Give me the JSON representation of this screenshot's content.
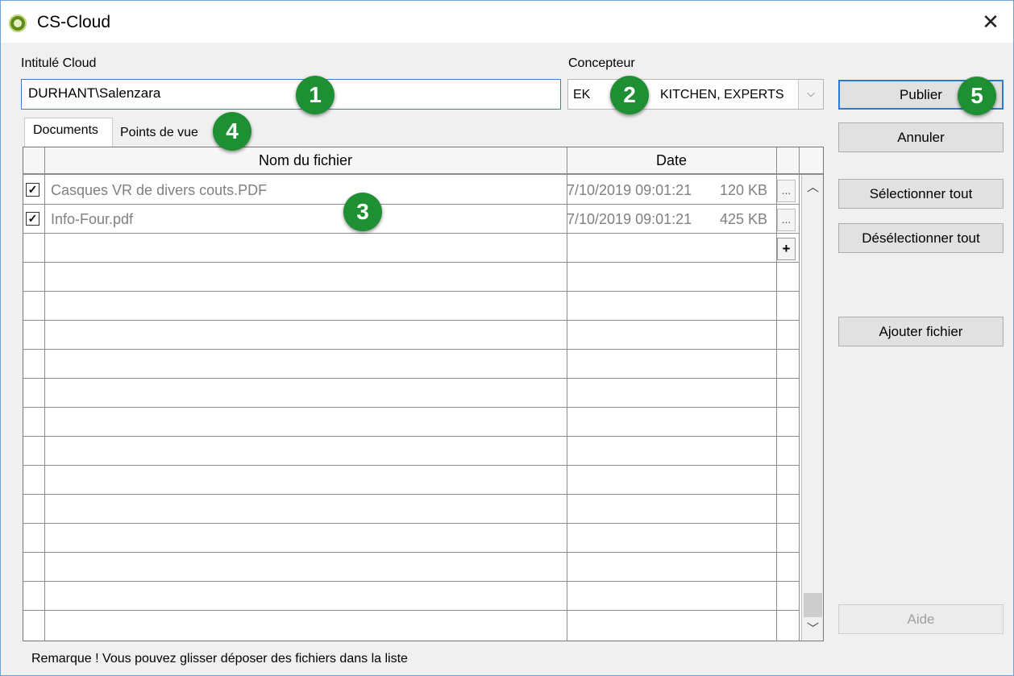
{
  "window": {
    "title": "CS-Cloud",
    "close_glyph": "✕"
  },
  "form": {
    "cloud_label": "Intitulé Cloud",
    "cloud_value": "DURHANT\\Salenzara",
    "designer_label": "Concepteur",
    "designer_code": "EK",
    "designer_name": "KITCHEN, EXPERTS"
  },
  "tabs": [
    {
      "label": "Documents",
      "active": true
    },
    {
      "label": "Points de vue",
      "active": false
    }
  ],
  "table": {
    "columns": [
      "Nom du fichier",
      "Date"
    ],
    "rows": [
      {
        "checked": true,
        "name": "Casques VR de divers couts.PDF",
        "date": "7/10/2019 09:01:21",
        "size": "120 KB",
        "action": "..."
      },
      {
        "checked": true,
        "name": "Info-Four.pdf",
        "date": "7/10/2019 09:01:21",
        "size": "425 KB",
        "action": "..."
      }
    ],
    "add_row_label": "+"
  },
  "buttons": {
    "publish": "Publier",
    "cancel": "Annuler",
    "select_all": "Sélectionner tout",
    "deselect_all": "Désélectionner tout",
    "add_file": "Ajouter fichier",
    "help": "Aide"
  },
  "note": "Remarque ! Vous pouvez glisser  déposer des fichiers dans la liste",
  "markers": [
    "1",
    "2",
    "3",
    "4",
    "5"
  ],
  "colors": {
    "marker": "#1f8f33",
    "accent_border": "#2a7bd4"
  }
}
